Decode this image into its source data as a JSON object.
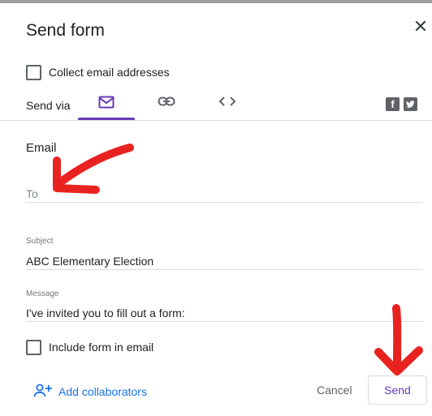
{
  "dialog": {
    "title": "Send form",
    "close_glyph": "✕"
  },
  "collect_email": {
    "label": "Collect email addresses",
    "checked": false
  },
  "send_via": {
    "label": "Send via",
    "tabs": [
      {
        "name": "email",
        "icon": "mail-icon",
        "active": true
      },
      {
        "name": "link",
        "icon": "link-icon",
        "active": false
      },
      {
        "name": "embed",
        "icon": "code-icon",
        "active": false
      }
    ],
    "social": [
      {
        "icon": "facebook-icon",
        "glyph": "f"
      },
      {
        "icon": "twitter-icon",
        "glyph": "t"
      }
    ]
  },
  "email": {
    "section_title": "Email",
    "to": {
      "placeholder": "To",
      "value": ""
    },
    "subject": {
      "label": "Subject",
      "value": "ABC Elementary Election"
    },
    "message": {
      "label": "Message",
      "value": "I've invited you to fill out a form:"
    },
    "include_form": {
      "label": "Include form in email",
      "checked": false
    }
  },
  "footer": {
    "add_collaborators": "Add collaborators",
    "cancel": "Cancel",
    "send": "Send"
  },
  "colors": {
    "accent": "#673ab7",
    "link": "#1a73e8",
    "annotation": "#e8231f"
  }
}
